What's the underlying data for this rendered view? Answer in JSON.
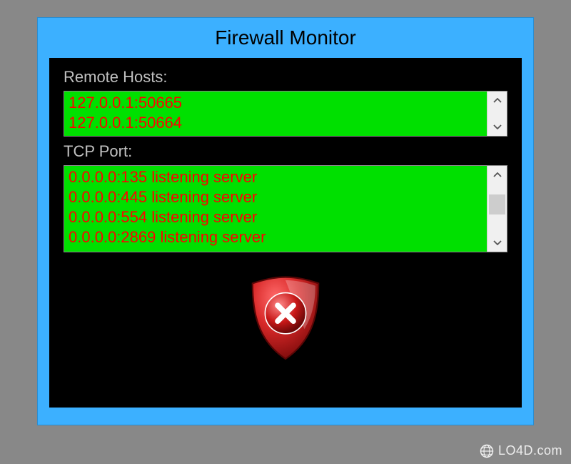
{
  "window": {
    "title": "Firewall Monitor"
  },
  "remote_hosts": {
    "label": "Remote Hosts:",
    "items": [
      "127.0.0.1:50665",
      "127.0.0.1:50664"
    ]
  },
  "tcp_port": {
    "label": "TCP Port:",
    "items": [
      "0.0.0.0:135 listening server",
      "0.0.0.0:445 listening server",
      "0.0.0.0:554 listening server",
      "0.0.0.0:2869 listening server"
    ]
  },
  "shield": {
    "icon": "shield-x-icon",
    "color": "#b01818"
  },
  "watermark": {
    "text": "LO4D.com"
  }
}
